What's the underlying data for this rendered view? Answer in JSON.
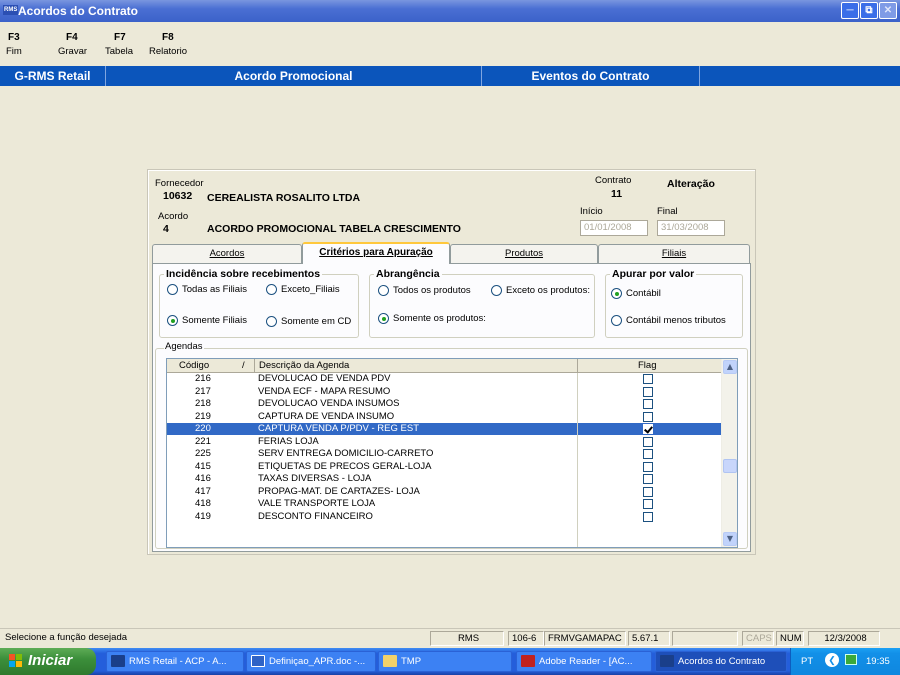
{
  "window": {
    "title": "Acordos do Contrato",
    "icon_text": "RMS"
  },
  "toolbar": {
    "keys": [
      {
        "key": "F3",
        "label": "Fim"
      },
      {
        "key": "F4",
        "label": "Gravar"
      },
      {
        "key": "F7",
        "label": "Tabela"
      },
      {
        "key": "F8",
        "label": "Relatorio"
      }
    ]
  },
  "menu": {
    "items": [
      "G-RMS Retail",
      "Acordo Promocional",
      "Eventos do Contrato"
    ]
  },
  "header": {
    "fornecedor_label": "Fornecedor",
    "fornecedor_code": "10632",
    "fornecedor_name": "CEREALISTA ROSALITO LTDA",
    "contrato_label": "Contrato",
    "contrato_value": "11",
    "mode": "Alteração",
    "acordo_label": "Acordo",
    "acordo_code": "4",
    "acordo_name": "ACORDO PROMOCIONAL TABELA CRESCIMENTO",
    "inicio_label": "Início",
    "inicio_value": "01/01/2008",
    "final_label": "Final",
    "final_value": "31/03/2008"
  },
  "tabs": [
    "Acordos",
    "Critérios para Apuração",
    "Produtos",
    "Filiais"
  ],
  "incidencia": {
    "title": "Incidência sobre recebimentos",
    "opt1": "Todas as Filiais",
    "opt2": "Exceto_Filiais",
    "opt3": "Somente Filiais",
    "opt4": "Somente  em CD",
    "selected": "Somente Filiais"
  },
  "abrangencia": {
    "title": "Abrangência",
    "opt1": "Todos os produtos",
    "opt2": "Exceto os produtos:",
    "opt3": "Somente os produtos:",
    "selected": "Somente os produtos:"
  },
  "apurar": {
    "title": "Apurar por valor",
    "opt1": "Contábil",
    "opt2": "Contábil menos tributos",
    "selected": "Contábil"
  },
  "agendas": {
    "legend": "Agendas",
    "columns": {
      "codigo": "Código",
      "sort": "/",
      "descricao": "Descrição da Agenda",
      "flag": "Flag"
    },
    "rows": [
      {
        "code": "216",
        "desc": "DEVOLUCAO DE VENDA PDV",
        "flag": false
      },
      {
        "code": "217",
        "desc": "VENDA ECF - MAPA RESUMO",
        "flag": false
      },
      {
        "code": "218",
        "desc": "DEVOLUCAO VENDA INSUMOS",
        "flag": false
      },
      {
        "code": "219",
        "desc": "CAPTURA DE VENDA INSUMO",
        "flag": false
      },
      {
        "code": "220",
        "desc": "CAPTURA VENDA P/PDV - REG EST",
        "flag": true,
        "selected": true
      },
      {
        "code": "221",
        "desc": "FERIAS LOJA",
        "flag": false
      },
      {
        "code": "225",
        "desc": "SERV ENTREGA DOMICILIO-CARRETO",
        "flag": false
      },
      {
        "code": "415",
        "desc": "ETIQUETAS DE PRECOS GERAL-LOJA",
        "flag": false
      },
      {
        "code": "416",
        "desc": "TAXAS DIVERSAS - LOJA",
        "flag": false
      },
      {
        "code": "417",
        "desc": "PROPAG-MAT. DE CARTAZES- LOJA",
        "flag": false
      },
      {
        "code": "418",
        "desc": "VALE TRANSPORTE LOJA",
        "flag": false
      },
      {
        "code": "419",
        "desc": "DESCONTO FINANCEIRO",
        "flag": false
      }
    ]
  },
  "status": {
    "message": "Selecione a função desejada",
    "system": "RMS",
    "code": "106-6",
    "program": "FRMVGAMAPAC",
    "version": "5.67.1",
    "caps": "CAPS",
    "num": "NUM",
    "date": "12/3/2008"
  },
  "taskbar": {
    "start": "Iniciar",
    "tasks": [
      "RMS Retail - ACP - A...",
      "Definiçao_APR.doc -...",
      "TMP",
      "Adobe Reader - [AC...",
      "Acordos do Contrato"
    ],
    "lang": "PT",
    "time": "19:35"
  },
  "colors": {
    "title_blue": "#3b62c9",
    "menu_blue": "#0b55bb",
    "selection": "#3169c6",
    "face": "#ece9d8"
  }
}
